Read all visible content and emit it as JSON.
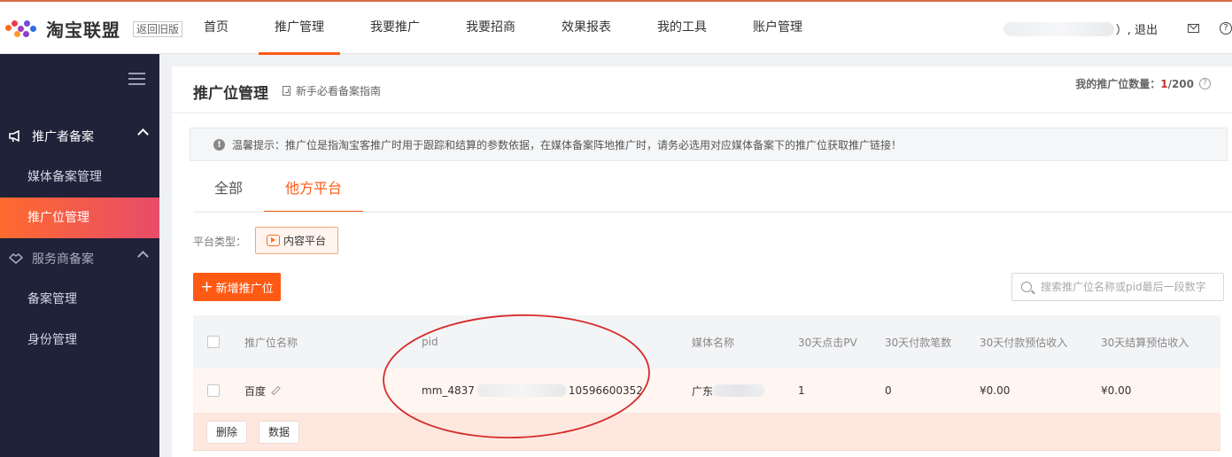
{
  "header": {
    "logo_text": "淘宝联盟",
    "old_version_label": "返回旧版",
    "nav": [
      {
        "label": "首页"
      },
      {
        "label": "推广管理"
      },
      {
        "label": "我要推广"
      },
      {
        "label": "我要招商"
      },
      {
        "label": "效果报表"
      },
      {
        "label": "我的工具"
      },
      {
        "label": "账户管理"
      }
    ],
    "user_suffix": "）, 退出",
    "mail_icon": "mail-icon",
    "help_icon": "?"
  },
  "sidebar": {
    "groups": [
      {
        "label": "推广者备案",
        "icon": "megaphone-icon",
        "items": [
          "媒体备案管理",
          "推广位管理"
        ]
      },
      {
        "label": "服务商备案",
        "icon": "handshake-icon",
        "items": [
          "备案管理",
          "身份管理"
        ]
      }
    ]
  },
  "main": {
    "title": "推广位管理",
    "guide_label": "新手必看备案指南",
    "quota_label": "我的推广位数量：",
    "quota_used": "1",
    "quota_total": "/200",
    "notice": "温馨提示：推广位是指淘宝客推广时用于跟踪和结算的参数依据，在媒体备案阵地推广时，请务必选用对应媒体备案下的推广位获取推广链接！",
    "tabs": [
      {
        "label": "全部"
      },
      {
        "label": "他方平台"
      }
    ],
    "platform_type_label": "平台类型：",
    "platform_type_value": "内容平台",
    "add_button": "新增推广位",
    "search_placeholder": "搜索推广位名称或pid最后一段数字"
  },
  "table": {
    "headers": [
      "推广位名称",
      "pid",
      "媒体名称",
      "30天点击PV",
      "30天付款笔数",
      "30天付款预估收入",
      "30天结算预估收入"
    ],
    "rows": [
      {
        "name": "百度",
        "pid_prefix": "mm_4837",
        "pid_suffix": "10596600352",
        "media": "广东",
        "pv": "1",
        "orders": "0",
        "pay_income": "¥0.00",
        "settle_income": "¥0.00"
      }
    ],
    "actions": [
      "删除",
      "数据"
    ]
  },
  "colors": {
    "accent": "#ff5a14",
    "sidebar_bg": "#1f2239",
    "annotation_ellipse": "#d62a2a"
  }
}
